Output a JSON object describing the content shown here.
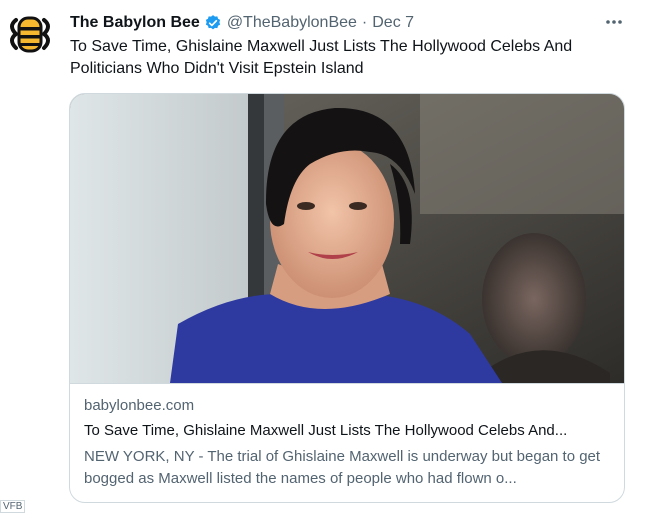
{
  "author": {
    "name": "The Babylon Bee",
    "handle": "@TheBabylonBee",
    "separator": "·",
    "date": "Dec 7",
    "avatar_icon": "babylon-bee-logo",
    "verified_icon": "verified-badge-icon"
  },
  "tweet": {
    "text": "To Save Time, Ghislaine Maxwell Just Lists The Hollywood Celebs And Politicians Who Didn't Visit Epstein Island",
    "more_icon": "more-options-icon"
  },
  "card": {
    "domain": "babylonbee.com",
    "title": "To Save Time, Ghislaine Maxwell Just Lists The Hollywood Celebs And...",
    "description": "NEW YORK, NY - The trial of Ghislaine Maxwell is underway but began to get bogged as Maxwell listed the names of people who had flown o..."
  },
  "page": {
    "corner_label": "VFB"
  },
  "colors": {
    "primary_text": "#0f1419",
    "secondary_text": "#536471",
    "border": "#cfd9de",
    "verified": "#1d9bf0",
    "logo_yellow": "#f5b82e"
  }
}
